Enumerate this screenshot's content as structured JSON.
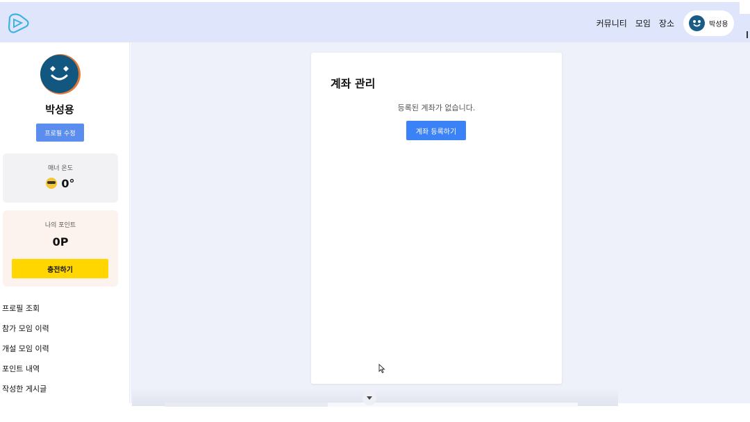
{
  "header": {
    "nav": [
      "커뮤니티",
      "모임",
      "장소"
    ],
    "user_name": "박성용"
  },
  "sidebar": {
    "profile_name": "박성용",
    "edit_label": "프로필 수정",
    "manner": {
      "label": "매너 온도",
      "value": "0°"
    },
    "points": {
      "label": "나의 포인트",
      "value": "0P",
      "charge_label": "충전하기"
    },
    "menu": [
      "프로필 조회",
      "참가 모임 이력",
      "개설 모임 이력",
      "포인트 내역",
      "작성한 게시글"
    ]
  },
  "main": {
    "title": "계좌 관리",
    "empty_text": "등록된 계좌가 없습니다.",
    "register_label": "계좌 등록하기"
  },
  "colors": {
    "header_bg": "#dfe6fb",
    "primary": "#3b82f6",
    "charge": "#ffd600"
  },
  "icons": [
    "logo-icon",
    "avatar",
    "sunglasses-emoji-icon",
    "cursor-icon",
    "chevron-down-icon"
  ]
}
